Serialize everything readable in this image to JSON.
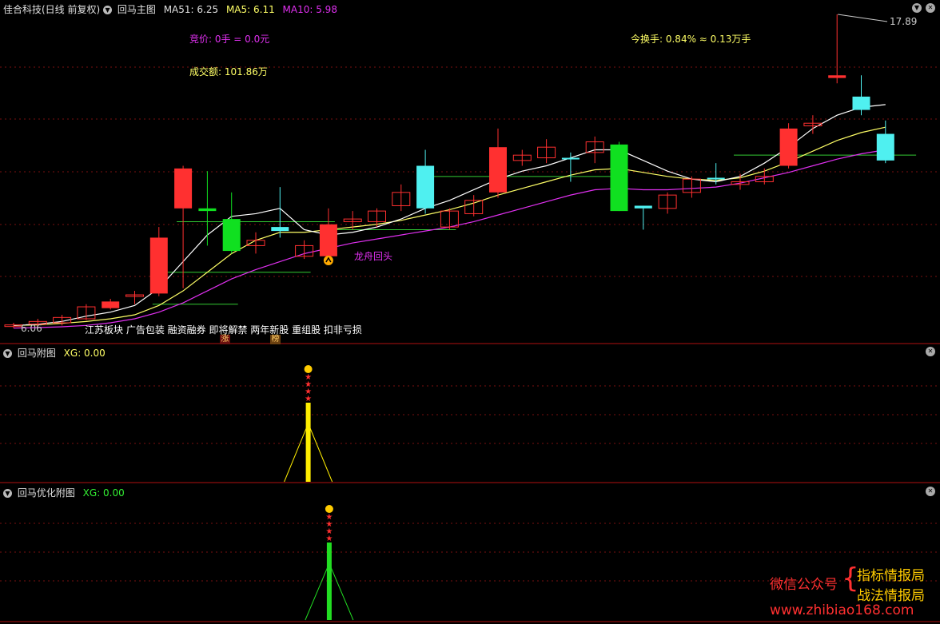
{
  "main_panel": {
    "stock_title": "佳合科技(日线 前复权)",
    "indicator_name": "回马主图",
    "ma51_label": "MA51: 6.25",
    "ma5_label": "MA5: 6.11",
    "ma10_label": "MA10: 5.98",
    "auction_label": "竞价: 0手 = 0.0元",
    "turnover_label": "今换手: 0.84% ≈ 0.13万手",
    "amount_label": "成交额: 101.86万",
    "high_price_label": "17.89",
    "low_price_label": "6.06",
    "signal_label": "龙舟回头",
    "concepts": "江苏板块 广告包装 融资融券 即将解禁 两年新股 重组股 扣非亏损",
    "marker_zhang": "涨",
    "marker_bang": "榜"
  },
  "sub_panel_1": {
    "title": "回马附图",
    "xg_label": "XG: 0.00"
  },
  "sub_panel_2": {
    "title": "回马优化附图",
    "xg_label": "XG: 0.00"
  },
  "watermark": {
    "wechat_label": "微信公众号",
    "name_1": "指标情报局",
    "name_2": "战法情报局",
    "url": "www.zhibiao168.com"
  },
  "colors": {
    "up": "#ff2020",
    "down_green": "#10e020",
    "cyan": "#4ff0f0",
    "ma5": "#ffffff",
    "ma10": "#ffff66",
    "ma51": "#e030f0",
    "panel_divider": "#b01010",
    "grid": "#7a1010",
    "ref_line": "#33cc33"
  },
  "chart_data": {
    "type": "candlestick",
    "price_range": [
      6.06,
      17.89
    ],
    "candles": [
      {
        "o": 6.2,
        "c": 6.22,
        "h": 6.3,
        "l": 6.1,
        "color": "hollow"
      },
      {
        "o": 6.25,
        "c": 6.35,
        "h": 6.45,
        "l": 6.15,
        "color": "hollow"
      },
      {
        "o": 6.3,
        "c": 6.5,
        "h": 6.6,
        "l": 6.2,
        "color": "hollow"
      },
      {
        "o": 6.45,
        "c": 6.9,
        "h": 7.0,
        "l": 6.4,
        "color": "hollow"
      },
      {
        "o": 7.1,
        "c": 6.85,
        "h": 7.2,
        "l": 6.8,
        "color": "red"
      },
      {
        "o": 7.3,
        "c": 7.35,
        "h": 7.5,
        "l": 7.0,
        "color": "hollow"
      },
      {
        "o": 7.4,
        "c": 9.5,
        "h": 9.9,
        "l": 7.3,
        "color": "red"
      },
      {
        "o": 10.6,
        "c": 12.1,
        "h": 12.2,
        "l": 7.6,
        "color": "red"
      },
      {
        "o": 10.6,
        "c": 10.5,
        "h": 12.0,
        "l": 9.2,
        "color": "green"
      },
      {
        "o": 10.2,
        "c": 9.0,
        "h": 11.2,
        "l": 8.9,
        "color": "green"
      },
      {
        "o": 9.2,
        "c": 9.4,
        "h": 9.7,
        "l": 8.9,
        "color": "hollow"
      },
      {
        "o": 9.9,
        "c": 9.75,
        "h": 11.4,
        "l": 9.5,
        "color": "cyan"
      },
      {
        "o": 8.8,
        "c": 9.2,
        "h": 9.4,
        "l": 8.7,
        "color": "hollow"
      },
      {
        "o": 8.8,
        "c": 10.0,
        "h": 10.6,
        "l": 8.7,
        "color": "red"
      },
      {
        "o": 10.1,
        "c": 10.2,
        "h": 10.5,
        "l": 9.8,
        "color": "hollow"
      },
      {
        "o": 10.1,
        "c": 10.5,
        "h": 10.6,
        "l": 9.9,
        "color": "hollow"
      },
      {
        "o": 10.7,
        "c": 11.2,
        "h": 11.5,
        "l": 10.5,
        "color": "hollow"
      },
      {
        "o": 10.6,
        "c": 12.2,
        "h": 12.8,
        "l": 10.4,
        "color": "cyan"
      },
      {
        "o": 9.9,
        "c": 10.5,
        "h": 10.6,
        "l": 9.8,
        "color": "hollow"
      },
      {
        "o": 10.4,
        "c": 10.9,
        "h": 11.1,
        "l": 10.3,
        "color": "hollow"
      },
      {
        "o": 11.2,
        "c": 12.9,
        "h": 13.6,
        "l": 11.0,
        "color": "red"
      },
      {
        "o": 12.4,
        "c": 12.6,
        "h": 12.8,
        "l": 12.2,
        "color": "hollow"
      },
      {
        "o": 12.5,
        "c": 12.9,
        "h": 13.2,
        "l": 12.3,
        "color": "hollow"
      },
      {
        "o": 12.45,
        "c": 12.5,
        "h": 12.7,
        "l": 11.6,
        "color": "cyan"
      },
      {
        "o": 12.7,
        "c": 13.1,
        "h": 13.3,
        "l": 12.3,
        "color": "hollow"
      },
      {
        "o": 13.0,
        "c": 10.5,
        "h": 13.1,
        "l": 10.5,
        "color": "green"
      },
      {
        "o": 10.7,
        "c": 10.6,
        "h": 10.7,
        "l": 9.8,
        "color": "cyan"
      },
      {
        "o": 10.6,
        "c": 11.1,
        "h": 11.2,
        "l": 10.4,
        "color": "hollow"
      },
      {
        "o": 11.2,
        "c": 11.7,
        "h": 11.8,
        "l": 11.0,
        "color": "hollow"
      },
      {
        "o": 11.7,
        "c": 11.75,
        "h": 12.3,
        "l": 11.5,
        "color": "cyan"
      },
      {
        "o": 11.5,
        "c": 11.6,
        "h": 11.9,
        "l": 11.3,
        "color": "hollow"
      },
      {
        "o": 11.6,
        "c": 11.8,
        "h": 12.1,
        "l": 11.5,
        "color": "hollow"
      },
      {
        "o": 12.2,
        "c": 13.6,
        "h": 13.8,
        "l": 12.1,
        "color": "red"
      },
      {
        "o": 13.7,
        "c": 13.8,
        "h": 14.1,
        "l": 13.4,
        "color": "hollow"
      },
      {
        "o": 15.5,
        "c": 15.6,
        "h": 17.89,
        "l": 15.3,
        "color": "red"
      },
      {
        "o": 14.8,
        "c": 14.3,
        "h": 15.6,
        "l": 14.1,
        "color": "cyan"
      },
      {
        "o": 13.4,
        "c": 12.4,
        "h": 13.9,
        "l": 12.3,
        "color": "cyan"
      }
    ],
    "ma5": [
      6.2,
      6.25,
      6.35,
      6.55,
      6.7,
      6.95,
      7.6,
      8.6,
      9.6,
      10.3,
      10.4,
      10.6,
      9.8,
      9.6,
      9.7,
      9.9,
      10.2,
      10.6,
      10.9,
      11.3,
      11.7,
      12.0,
      12.2,
      12.5,
      12.8,
      12.8,
      12.4,
      12.0,
      11.7,
      11.6,
      11.8,
      12.3,
      12.9,
      13.6,
      14.1,
      14.4,
      14.5
    ],
    "ma10": [
      6.2,
      6.22,
      6.28,
      6.35,
      6.45,
      6.6,
      6.95,
      7.5,
      8.2,
      8.9,
      9.4,
      9.7,
      9.7,
      9.8,
      9.9,
      10.0,
      10.15,
      10.35,
      10.55,
      10.8,
      11.1,
      11.35,
      11.6,
      11.85,
      12.05,
      12.1,
      11.95,
      11.8,
      11.7,
      11.65,
      11.75,
      12.0,
      12.35,
      12.75,
      13.15,
      13.45,
      13.65
    ],
    "ma51": [
      6.1,
      6.12,
      6.15,
      6.2,
      6.3,
      6.45,
      6.7,
      7.05,
      7.5,
      7.95,
      8.3,
      8.6,
      8.9,
      9.1,
      9.3,
      9.45,
      9.6,
      9.75,
      9.9,
      10.1,
      10.35,
      10.6,
      10.85,
      11.1,
      11.3,
      11.35,
      11.3,
      11.3,
      11.35,
      11.4,
      11.55,
      11.75,
      11.95,
      12.2,
      12.45,
      12.65,
      12.8
    ],
    "signal_candle_index": 13,
    "sub_spike_candle_index": 13
  }
}
